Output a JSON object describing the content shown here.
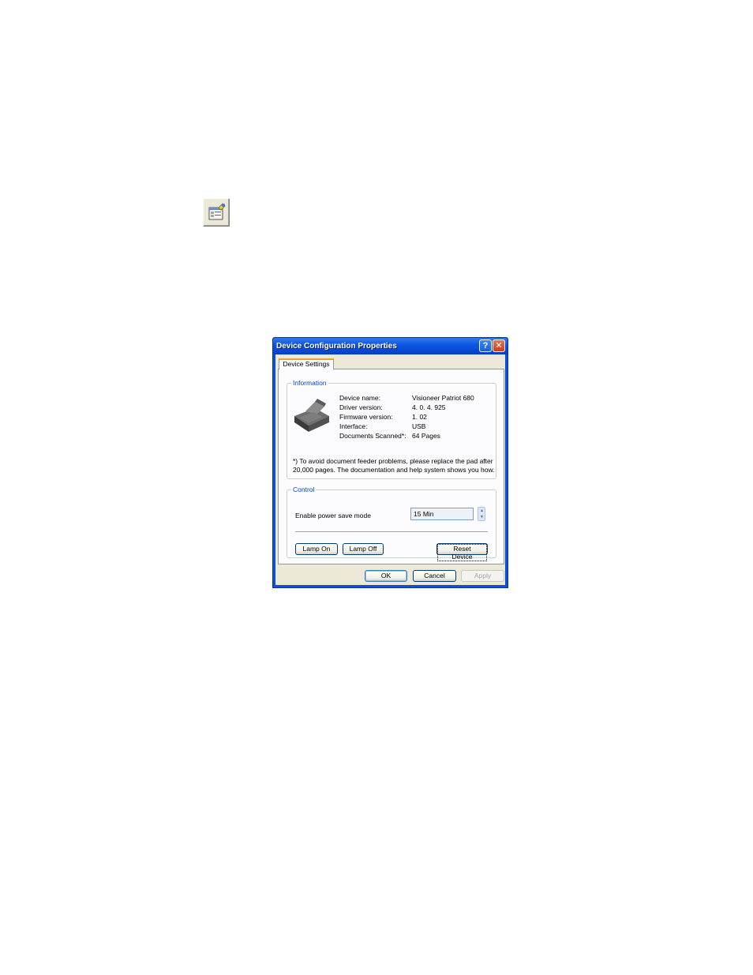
{
  "dialog": {
    "title": "Device Configuration Properties",
    "help_label": "?",
    "close_label": "✕",
    "tab_label": "Device Settings",
    "information": {
      "legend": "Information",
      "rows": [
        {
          "label": "Device name:",
          "value": "Visioneer Patriot 680"
        },
        {
          "label": "Driver version:",
          "value": "4. 0. 4. 925"
        },
        {
          "label": "Firmware version:",
          "value": "1. 02"
        },
        {
          "label": "Interface:",
          "value": "USB"
        },
        {
          "label": "Documents Scanned*:",
          "value": " 64 Pages"
        }
      ],
      "note": "*) To avoid document feeder problems, please replace the pad after 20,000 pages. The documentation and help system shows you how."
    },
    "control": {
      "legend": "Control",
      "power_save_label": "Enable power save mode",
      "power_save_value": "15 Min",
      "lamp_on": "Lamp On",
      "lamp_off": "Lamp Off",
      "reset_device": "Reset Device"
    },
    "buttons": {
      "ok": "OK",
      "cancel": "Cancel",
      "apply": "Apply"
    }
  }
}
